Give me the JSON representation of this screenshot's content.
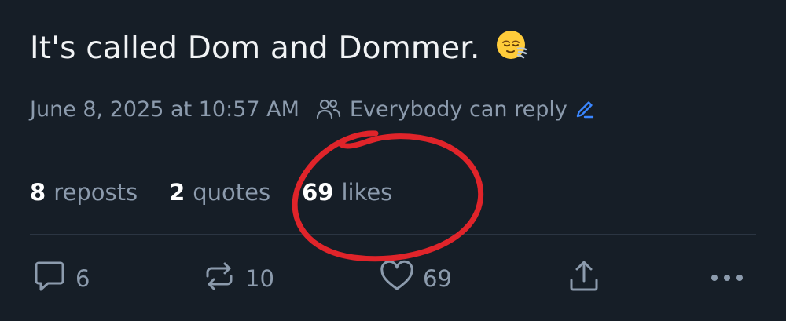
{
  "post": {
    "text": "It's called Dom and Dommer.",
    "emoji": "relieved-face-emoji",
    "timestamp": "June 8, 2025 at 10:57 AM",
    "reply_setting": "Everybody can reply"
  },
  "stats": {
    "reposts_count": "8",
    "reposts_label": "reposts",
    "quotes_count": "2",
    "quotes_label": "quotes",
    "likes_count": "69",
    "likes_label": "likes"
  },
  "actions": {
    "reply_count": "6",
    "repost_count": "10",
    "like_count": "69"
  },
  "icons": {
    "reply": "speech-bubble-icon",
    "repost": "repost-arrows-icon",
    "like": "heart-icon",
    "share": "share-icon",
    "more": "more-dots-icon",
    "people": "people-icon",
    "edit": "pencil-icon"
  },
  "colors": {
    "background": "#161e27",
    "text_primary": "#f1f3f5",
    "text_secondary": "#8c9bad",
    "accent": "#3a86ff",
    "annotation": "#e0242a"
  }
}
